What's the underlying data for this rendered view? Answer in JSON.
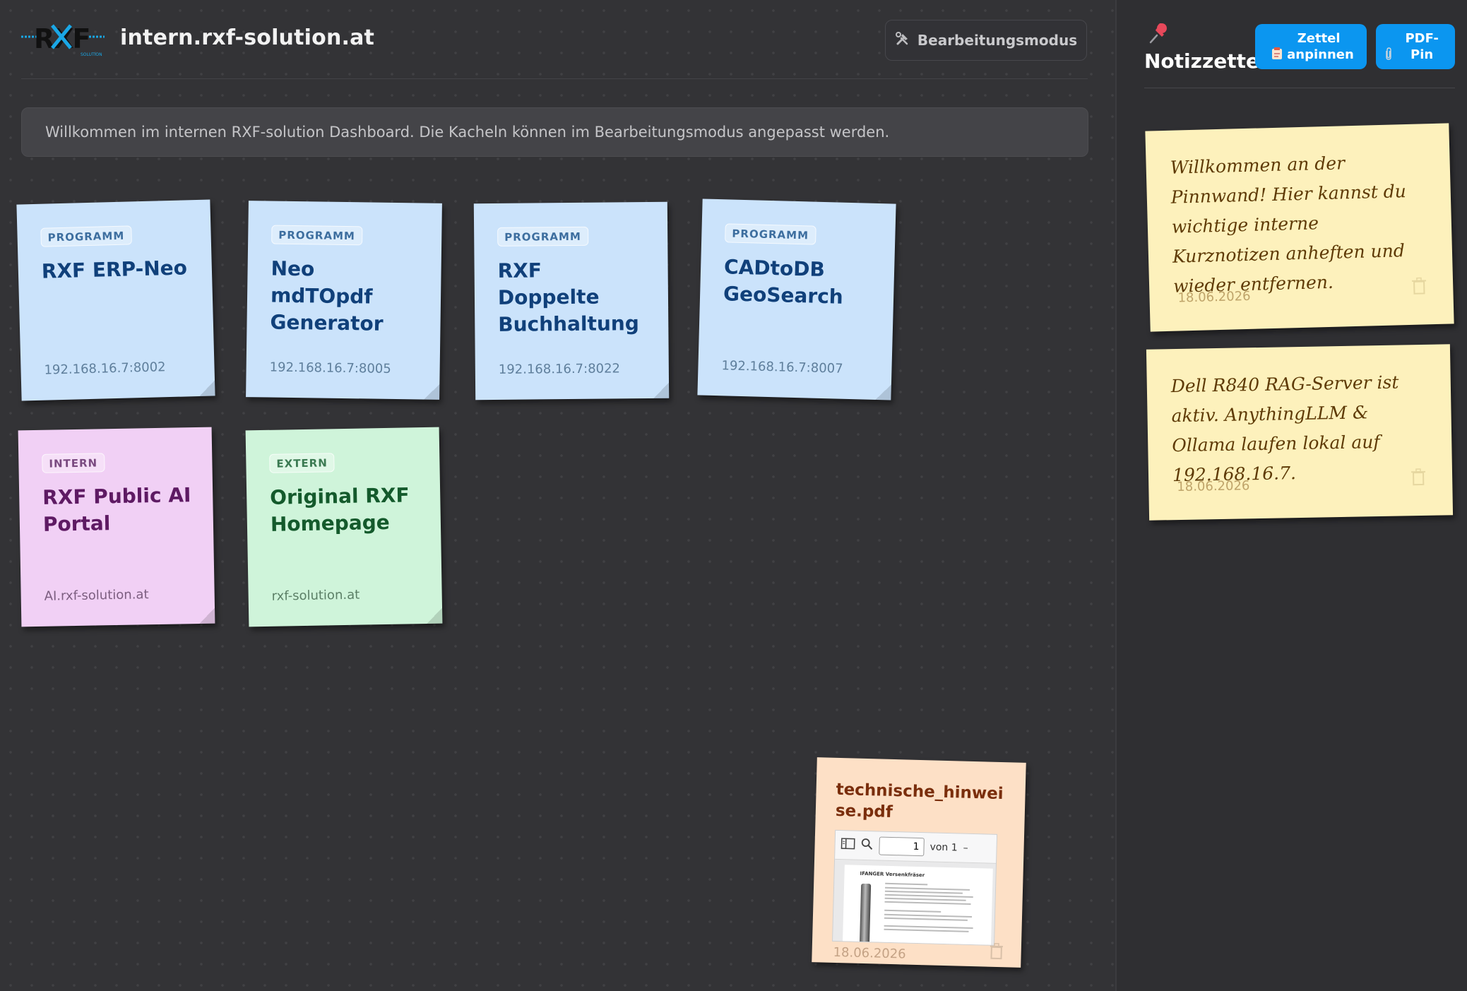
{
  "header": {
    "site_title": "intern.rxf-solution.at",
    "logo_text": "RXF",
    "logo_subtext": "SOLUTION",
    "edit_mode_button": "Bearbeitungsmodus"
  },
  "welcome_text": "Willkommen im internen RXF-solution Dashboard. Die Kacheln können im Bearbeitungsmodus angepasst werden.",
  "tiles": [
    {
      "badge": "PROGRAMM",
      "title": "RXF ERP-Neo",
      "address": "192.168.16.7:8002",
      "color": "#cbe3fb"
    },
    {
      "badge": "PROGRAMM",
      "title": "Neo mdTOpdf Generator",
      "address": "192.168.16.7:8005",
      "color": "#cbe3fb"
    },
    {
      "badge": "PROGRAMM",
      "title": "RXF Doppelte Buchhaltung",
      "address": "192.168.16.7:8022",
      "color": "#cbe3fb"
    },
    {
      "badge": "PROGRAMM",
      "title": "CADtoDB GeoSearch",
      "address": "192.168.16.7:8007",
      "color": "#cbe3fb"
    },
    {
      "badge": "INTERN",
      "title": "RXF Public AI Portal",
      "address": "AI.rxf-solution.at",
      "color": "#f1d0f5"
    },
    {
      "badge": "EXTERN",
      "title": "Original RXF Homepage",
      "address": "rxf-solution.at",
      "color": "#cff4da"
    }
  ],
  "pdf_note": {
    "title": "technische_hinweise.pdf",
    "page_input": "1",
    "page_total": "von 1",
    "doc_heading": "IFANGER Versenkfräser",
    "date": "18.06.2026"
  },
  "sidebar": {
    "title": "Notizzettel",
    "pin_note_button": "Zettel anpinnen",
    "pdf_pin_button": "PDF-Pin",
    "notes": [
      {
        "text": "Willkommen an der Pinnwand! Hier kannst du wichtige interne Kurznotizen anheften und wieder entfernen.",
        "date": "18.06.2026"
      },
      {
        "text": "Dell R840 RAG-Server ist aktiv. AnythingLLM & Ollama laufen lokal auf 192.168.16.7.",
        "date": "18.06.2026"
      }
    ]
  },
  "colors": {
    "background": "#333336",
    "accent_button": "#0b96f0",
    "sticky_note": "#fdf1bc"
  }
}
